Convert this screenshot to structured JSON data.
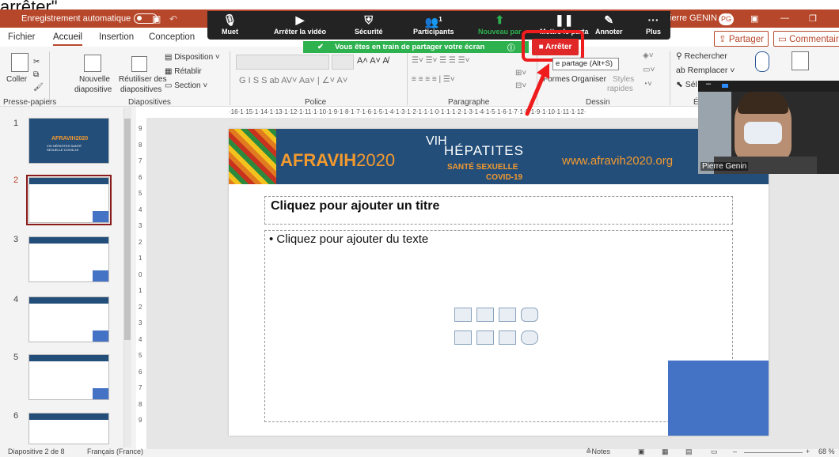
{
  "caption": "arrêter\".",
  "titlebar": {
    "autosave": "Enregistrement automatique",
    "user": "ierre GENIN",
    "initials": "PG"
  },
  "zoom": {
    "items": [
      {
        "label": "Muet",
        "glyph": "🎙"
      },
      {
        "label": "Arrêter la vidéo",
        "glyph": "▶"
      },
      {
        "label": "Sécurité",
        "glyph": "⛨"
      },
      {
        "label": "Participants",
        "glyph": "👥",
        "count": "1"
      },
      {
        "label": "Nouveau par",
        "glyph": "⬆"
      },
      {
        "label": "Mettre le parta",
        "glyph": "❚❚"
      },
      {
        "label": "Annoter",
        "glyph": "✎"
      },
      {
        "label": "Plus",
        "glyph": "···"
      }
    ],
    "sharing_text": "Vous êtes en train de partager votre écran",
    "stop_label": "Arrêter",
    "tooltip": "e partage (Alt+S)"
  },
  "tabs": [
    "Fichier",
    "Accueil",
    "Insertion",
    "Conception"
  ],
  "share_label": "Partager",
  "comments_label": "Commentaires",
  "ribbon": {
    "coller": "Coller",
    "nouvelle": "Nouvelle",
    "nouvelle2": "diapositive",
    "reutiliser": "Réutiliser des",
    "reutiliser2": "diapositives",
    "disposition": "Disposition",
    "retablir": "Rétablir",
    "section": "Section",
    "formes": "Formes",
    "organiser": "Organiser",
    "styles": "Styles",
    "rapides": "rapides",
    "rechercher": "Rechercher",
    "remplacer": "Remplacer",
    "selectionner": "Sél",
    "groups": [
      "Presse-papiers",
      "Diapositives",
      "Police",
      "Paragraphe",
      "Dessin",
      "É"
    ]
  },
  "hruler": "·16·1·15·1·14·1·13·1·12·1·11·1·10·1·9·1·8·1·7·1·6·1·5·1·4·1·3·1·2·1·1·1·0·1·1·1·2·1·3·1·4·1·5·1·6·1·7·1·8·1·9·1·10·1·11·1·12·",
  "thumbnails": [
    {
      "num": "1",
      "title": "AFRAVIH2020",
      "sub": "VIH HÉPATITES SANTÉ SEXUELLE COVID-19"
    },
    {
      "num": "2"
    },
    {
      "num": "3"
    },
    {
      "num": "4"
    },
    {
      "num": "5"
    },
    {
      "num": "6"
    }
  ],
  "slide": {
    "brand": "AFRAVIH",
    "year": "2020",
    "vih": "VIH",
    "hepatites": "HÉPATITES",
    "sante": "SANTÉ SEXUELLE",
    "covid": "COVID-19",
    "url": "www.afravih2020.org",
    "title_placeholder": "Cliquez pour ajouter un titre",
    "body_placeholder": "• Cliquez pour ajouter du texte"
  },
  "video": {
    "name": "Pierre Genin"
  },
  "status": {
    "slide_info": "Diapositive 2 de 8",
    "language": "Français (France)",
    "notes": "Notes",
    "zoom": "68 %"
  },
  "colors": {
    "accent": "#b7472a",
    "zoom_green": "#2db24f",
    "stop_red": "#e02828",
    "banner": "#234e7a",
    "orange": "#f39a2e",
    "placeholder_blue": "#4472c4"
  }
}
